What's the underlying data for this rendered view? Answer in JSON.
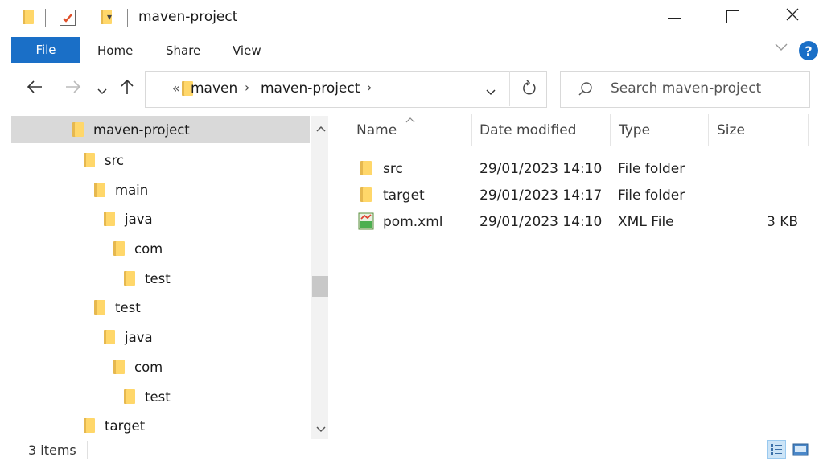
{
  "window": {
    "title": "maven-project"
  },
  "ribbon": {
    "file": "File",
    "home": "Home",
    "share": "Share",
    "view": "View"
  },
  "address": {
    "overflow": "«",
    "crumb1": "maven",
    "crumb2": "maven-project"
  },
  "search": {
    "placeholder": "Search maven-project"
  },
  "tree": {
    "items": [
      {
        "label": "maven-project",
        "selected": true
      },
      {
        "label": "src"
      },
      {
        "label": "main"
      },
      {
        "label": "java"
      },
      {
        "label": "com"
      },
      {
        "label": "test"
      },
      {
        "label": "test"
      },
      {
        "label": "java"
      },
      {
        "label": "com"
      },
      {
        "label": "test"
      },
      {
        "label": "target"
      }
    ]
  },
  "columns": {
    "name": "Name",
    "date": "Date modified",
    "type": "Type",
    "size": "Size"
  },
  "files": [
    {
      "name": "src",
      "date": "29/01/2023 14:10",
      "type": "File folder",
      "size": "",
      "icon": "folder-icon"
    },
    {
      "name": "target",
      "date": "29/01/2023 14:17",
      "type": "File folder",
      "size": "",
      "icon": "folder-icon"
    },
    {
      "name": "pom.xml",
      "date": "29/01/2023 14:10",
      "type": "XML File",
      "size": "3 KB",
      "icon": "xml-file-icon"
    }
  ],
  "status": {
    "count": "3 items"
  },
  "colors": {
    "accent": "#1a6fc7",
    "folder": "#ffd76a",
    "selected": "#d9d9d9"
  }
}
